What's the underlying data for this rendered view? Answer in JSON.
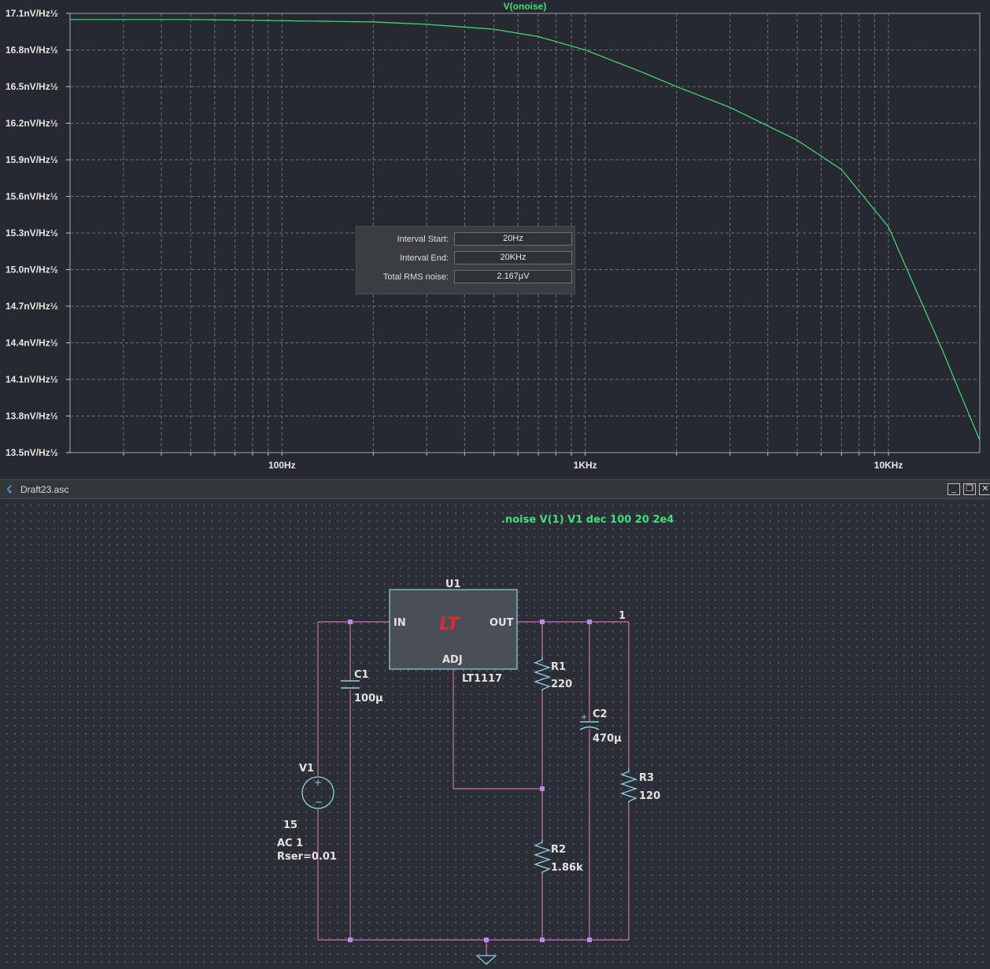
{
  "waveform": {
    "trace_name": "V(onoise)",
    "y_ticks": [
      "17.1nV/Hz½",
      "16.8nV/Hz½",
      "16.5nV/Hz½",
      "16.2nV/Hz½",
      "15.9nV/Hz½",
      "15.6nV/Hz½",
      "15.3nV/Hz½",
      "15.0nV/Hz½",
      "14.7nV/Hz½",
      "14.4nV/Hz½",
      "14.1nV/Hz½",
      "13.8nV/Hz½",
      "13.5nV/Hz½"
    ],
    "x_ticks": [
      "100Hz",
      "1KHz",
      "10KHz"
    ],
    "trace_color": "#3fe07a",
    "background": "#262a30",
    "grid_color": "#6b7080"
  },
  "chart_data": {
    "type": "line",
    "title": "V(onoise)",
    "xlabel": "",
    "ylabel": "",
    "x_scale": "log",
    "xlim": [
      20,
      20000
    ],
    "ylim": [
      13.5,
      17.1
    ],
    "series": [
      {
        "name": "V(onoise)",
        "x": [
          20,
          50,
          100,
          200,
          300,
          500,
          700,
          1000,
          1500,
          2000,
          3000,
          5000,
          7000,
          10000,
          12000,
          15000,
          20000
        ],
        "y": [
          17.05,
          17.05,
          17.04,
          17.03,
          17.01,
          16.97,
          16.91,
          16.8,
          16.63,
          16.5,
          16.33,
          16.06,
          15.82,
          15.35,
          14.9,
          14.35,
          13.6
        ]
      }
    ]
  },
  "rms_dialog": {
    "rows": [
      {
        "label": "Interval Start:",
        "value": "20Hz"
      },
      {
        "label": "Interval End:",
        "value": "20KHz"
      },
      {
        "label": "Total RMS noise:",
        "value": "2.167µV"
      }
    ]
  },
  "schematic_window": {
    "title": "Draft23.asc",
    "buttons": {
      "minimize": "_",
      "restore": "❐",
      "close": "✕"
    }
  },
  "schematic": {
    "directive": ".noise V(1) V1 dec 100 20 2e4",
    "u1": {
      "ref": "U1",
      "part": "LT1117",
      "pin_in": "IN",
      "pin_out": "OUT",
      "pin_adj": "ADJ",
      "logo": "LT"
    },
    "net_label": "1",
    "c1": {
      "ref": "C1",
      "value": "100µ"
    },
    "c2": {
      "ref": "C2",
      "value": "470µ"
    },
    "r1": {
      "ref": "R1",
      "value": "220"
    },
    "r2": {
      "ref": "R2",
      "value": "1.86k"
    },
    "r3": {
      "ref": "R3",
      "value": "120"
    },
    "v1": {
      "ref": "V1",
      "dc": "15",
      "ac": "AC 1",
      "rser": "Rser=0.01"
    },
    "wire_color": "#d46fb3",
    "symbol_color": "#8fd1e6",
    "junction_color": "#b48cf0"
  }
}
